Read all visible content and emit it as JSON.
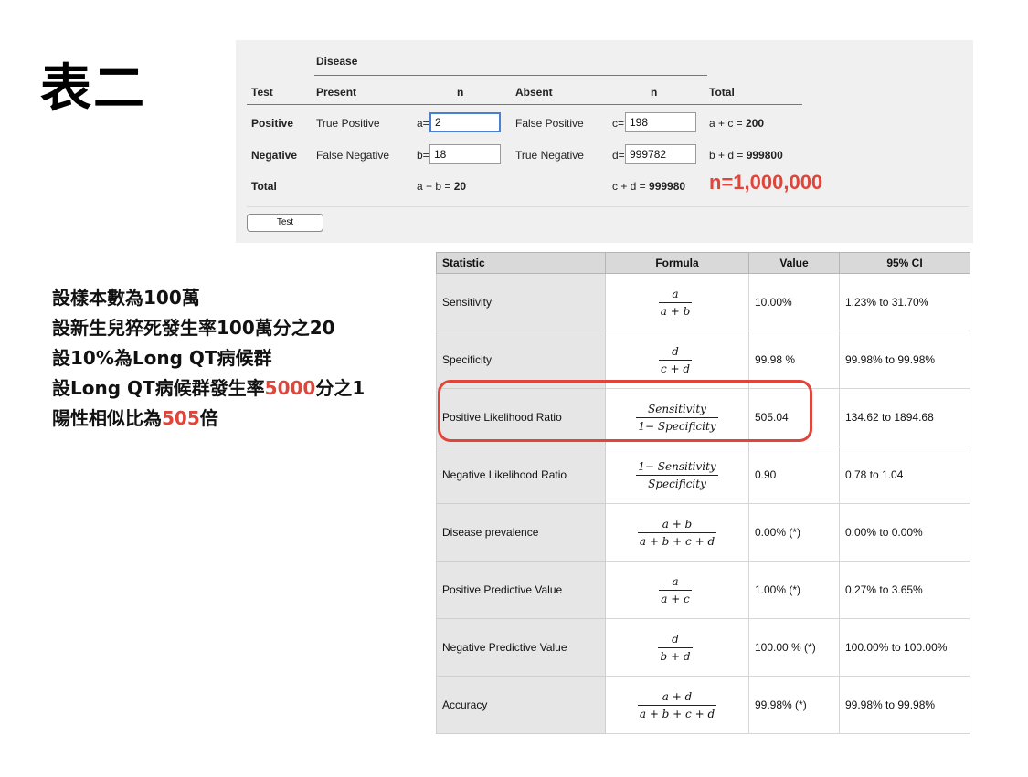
{
  "slide": {
    "title": "表二"
  },
  "calculator": {
    "header_disease": "Disease",
    "col_test": "Test",
    "col_present": "Present",
    "col_n1": "n",
    "col_absent": "Absent",
    "col_n2": "n",
    "col_total": "Total",
    "row_positive": "Positive",
    "row_negative": "Negative",
    "row_total": "Total",
    "true_positive": "True Positive",
    "false_positive": "False Positive",
    "false_negative": "False Negative",
    "true_negative": "True Negative",
    "a_prefix": "a=",
    "a_value": "2",
    "b_prefix": "b=",
    "b_value": "18",
    "c_prefix": "c=",
    "c_value": "198",
    "d_prefix": "d=",
    "d_value": "999782",
    "ac_label": "a + c = ",
    "ac_value": "200",
    "bd_label": "b + d = ",
    "bd_value": "999800",
    "ab_label": "a + b = ",
    "ab_value": "20",
    "cd_label": "c + d = ",
    "cd_value": "999980",
    "n_total": "n=1,000,000",
    "test_button": "Test"
  },
  "notes": {
    "line1": "設樣本數為100萬",
    "line2": "設新生兒猝死發生率100萬分之20",
    "line3": "設10%為Long QT病候群",
    "line4_a": "設Long QT病候群發生率",
    "line4_b": "5000",
    "line4_c": "分之1",
    "line5_a": "陽性相似比為",
    "line5_b": "505",
    "line5_c": "倍"
  },
  "results": {
    "headers": [
      "Statistic",
      "Formula",
      "Value",
      "95% CI"
    ],
    "rows": [
      {
        "stat": "Sensitivity",
        "num": "a",
        "den": "a + b",
        "value": "10.00%",
        "ci": "1.23% to 31.70%"
      },
      {
        "stat": "Specificity",
        "num": "d",
        "den": "c + d",
        "value": "99.98 %",
        "ci": "99.98% to 99.98%"
      },
      {
        "stat": "Positive Likelihood Ratio",
        "num": "Sensitivity",
        "den": "1− Specificity",
        "value": "505.04",
        "ci": "134.62 to 1894.68"
      },
      {
        "stat": "Negative Likelihood Ratio",
        "num": "1− Sensitivity",
        "den": "Specificity",
        "value": "0.90",
        "ci": "0.78 to 1.04"
      },
      {
        "stat": "Disease prevalence",
        "num": "a + b",
        "den": "a + b + c + d",
        "value": "0.00% (*)",
        "ci": "0.00% to 0.00%"
      },
      {
        "stat": "Positive Predictive Value",
        "num": "a",
        "den": "a + c",
        "value": "1.00% (*)",
        "ci": "0.27% to 3.65%"
      },
      {
        "stat": "Negative Predictive Value",
        "num": "d",
        "den": "b + d",
        "value": "100.00 % (*)",
        "ci": "100.00% to 100.00%"
      },
      {
        "stat": "Accuracy",
        "num": "a + d",
        "den": "a + b + c + d",
        "value": "99.98% (*)",
        "ci": "99.98% to 99.98%"
      }
    ]
  },
  "colors": {
    "accent_red": "#e0453a",
    "focus_blue": "#4a7fd6"
  }
}
